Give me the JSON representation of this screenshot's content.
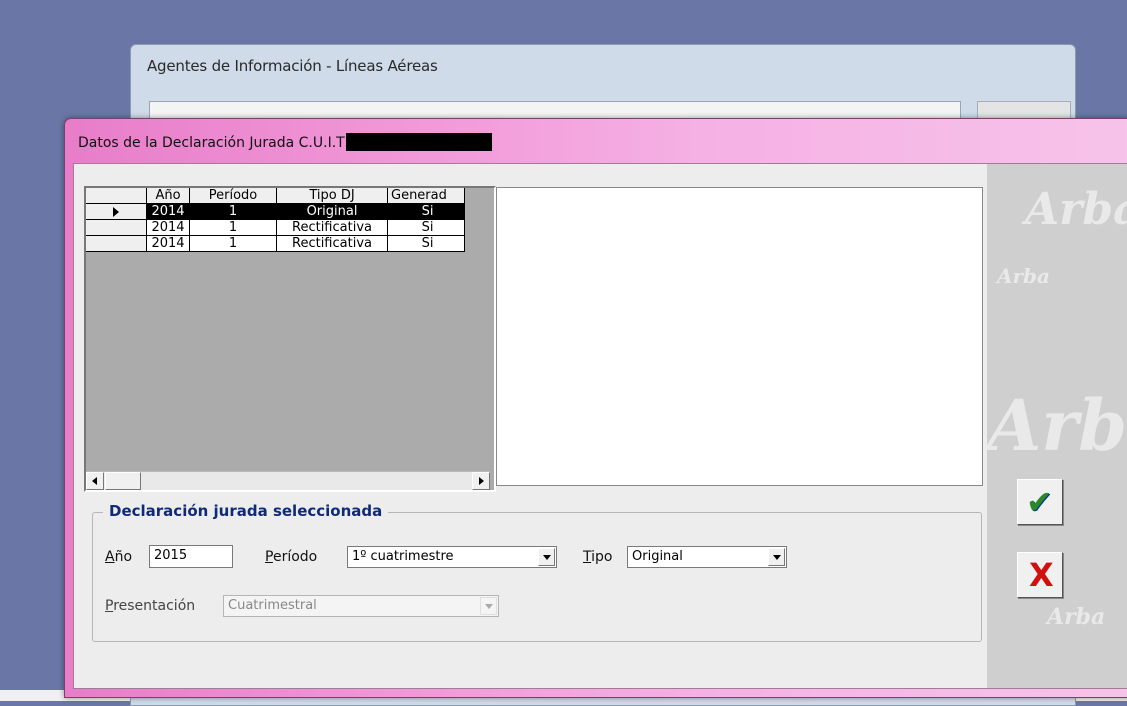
{
  "background_window": {
    "title": "Agentes de Información - Líneas Aéreas"
  },
  "dialog": {
    "title": "Datos de la Declaración Jurada C.U.I.T"
  },
  "grid": {
    "columns": [
      "Año",
      "Período",
      "Tipo DJ",
      "Generad"
    ],
    "rows": [
      {
        "anio": "2014",
        "periodo": "1",
        "tipo": "Original",
        "generada": "Si",
        "selected": true
      },
      {
        "anio": "2014",
        "periodo": "1",
        "tipo": "Rectificativa",
        "generada": "Si",
        "selected": false
      },
      {
        "anio": "2014",
        "periodo": "1",
        "tipo": "Rectificativa",
        "generada": "Si",
        "selected": false
      }
    ]
  },
  "selected_dj": {
    "legend": "Declaración jurada seleccionada",
    "anio_label": "Año",
    "anio_value": "2015",
    "periodo_label": "Período",
    "periodo_value": "1º cuatrimestre",
    "tipo_label": "Tipo",
    "tipo_value": "Original",
    "presentacion_label": "Presentación",
    "presentacion_value": "Cuatrimestral"
  },
  "buttons": {
    "accept_icon": "check-icon",
    "cancel_icon": "x-icon"
  },
  "colors": {
    "title_gradient_start": "#e87dc9",
    "title_gradient_end": "#f7c3ea",
    "legend_text": "#102a7a",
    "accept": "#2a8a2a",
    "cancel": "#d01010"
  }
}
